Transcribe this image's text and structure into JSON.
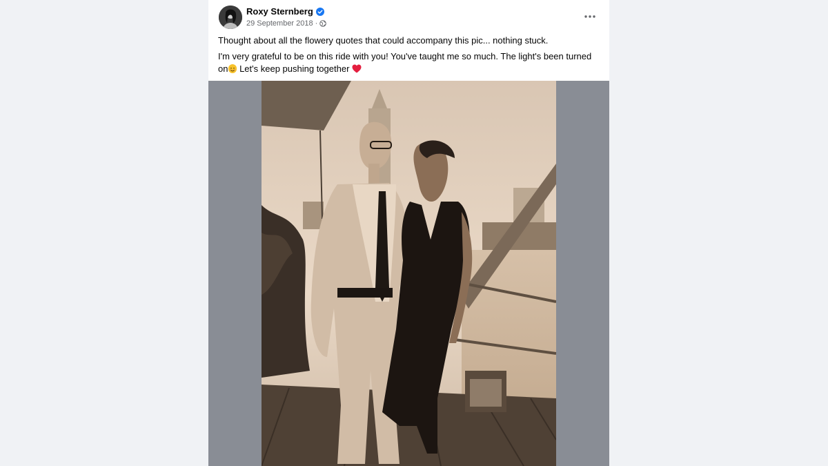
{
  "post": {
    "author": "Roxy Sternberg",
    "date": "29 September 2018",
    "separator": "·",
    "text_line1": "Thought about all the flowery quotes that could accompany this pic... nothing stuck.",
    "text_line2_a": "I'm very grateful to be on this ride with you! You've taught me so much. The light's been turned on",
    "text_line2_b": " Let's keep pushing together",
    "icons": [
      "verified-badge-icon",
      "globe-icon",
      "more-options-icon",
      "smile-emoji-icon",
      "heart-emoji-icon"
    ],
    "colors": {
      "verified": "#1877f2",
      "heart": "#e41e3f",
      "media_bg": "#898d95"
    }
  }
}
